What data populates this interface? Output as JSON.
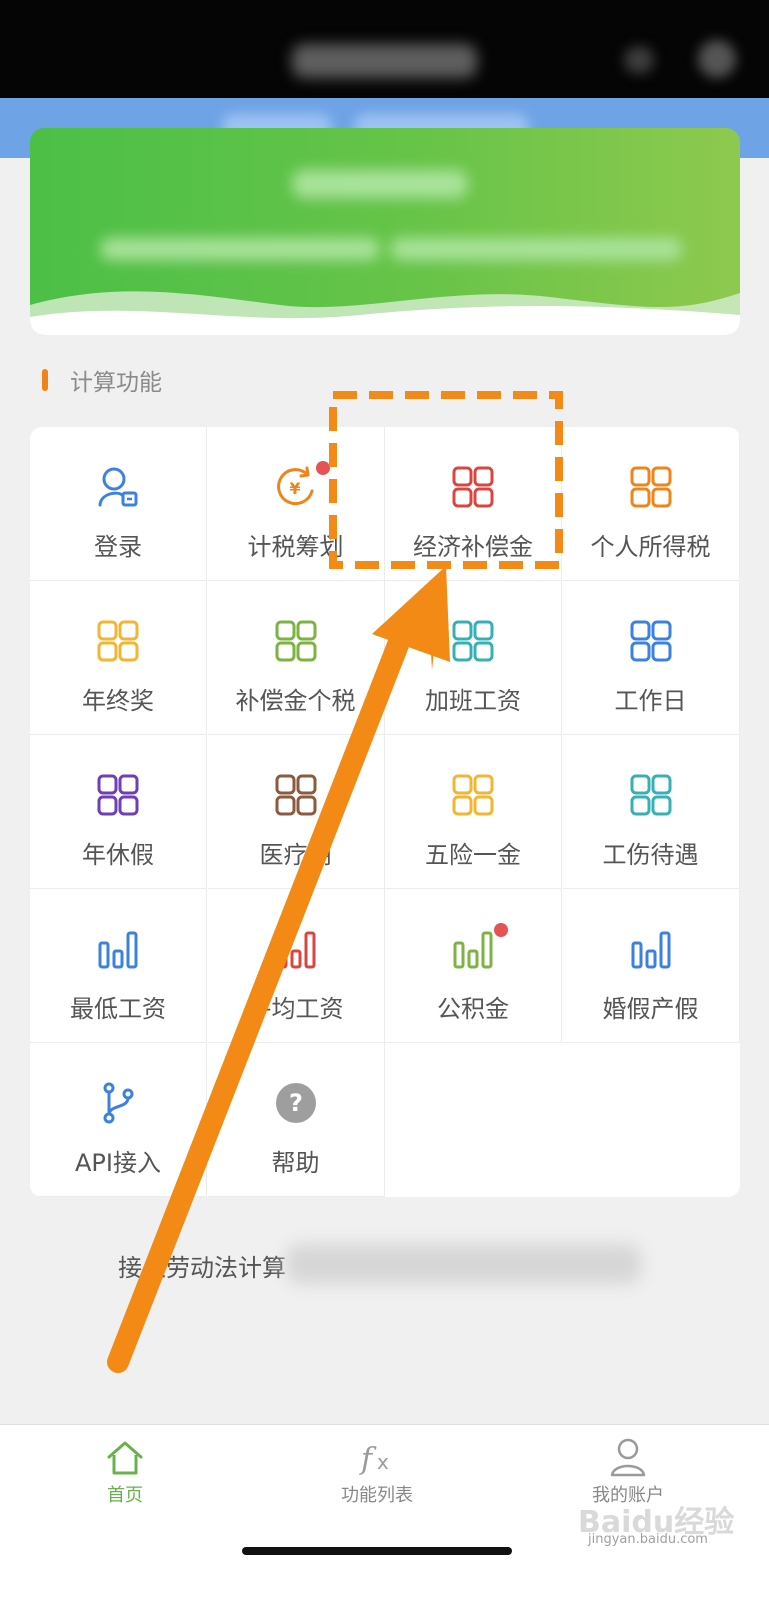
{
  "section": {
    "title": "计算功能"
  },
  "grid": [
    {
      "label": "登录",
      "icon": "user-login-icon",
      "color": "#3b82e0"
    },
    {
      "label": "计税筹划",
      "icon": "yuan-cycle-icon",
      "color": "#f08418",
      "badge": true
    },
    {
      "label": "经济补偿金",
      "icon": "grid-apps-icon",
      "color": "#d9453f"
    },
    {
      "label": "个人所得税",
      "icon": "grid-apps-icon",
      "color": "#f08418"
    },
    {
      "label": "年终奖",
      "icon": "grid-apps-icon",
      "color": "#f2b632"
    },
    {
      "label": "补偿金个税",
      "icon": "grid-apps-icon",
      "color": "#7cb342"
    },
    {
      "label": "加班工资",
      "icon": "grid-apps-icon",
      "color": "#35b0b5"
    },
    {
      "label": "工作日",
      "icon": "grid-apps-icon",
      "color": "#3b82e0"
    },
    {
      "label": "年休假",
      "icon": "grid-apps-icon",
      "color": "#6f3fb8"
    },
    {
      "label": "医疗期",
      "icon": "grid-apps-icon",
      "color": "#8d5a3c"
    },
    {
      "label": "五险一金",
      "icon": "grid-apps-icon",
      "color": "#f2b632"
    },
    {
      "label": "工伤待遇",
      "icon": "grid-apps-icon",
      "color": "#35b0b5"
    },
    {
      "label": "最低工资",
      "icon": "bar-chart-icon",
      "color": "#3b82e0"
    },
    {
      "label": "平均工资",
      "icon": "bar-chart-icon",
      "color": "#d9453f"
    },
    {
      "label": "公积金",
      "icon": "bar-chart-icon",
      "color": "#7cb342",
      "badge": true
    },
    {
      "label": "婚假产假",
      "icon": "bar-chart-icon",
      "color": "#3b82e0"
    },
    {
      "label": "API接入",
      "icon": "branch-icon",
      "color": "#3b82e0"
    },
    {
      "label": "帮助",
      "icon": "question-circle-icon",
      "color": "#9e9e9e"
    }
  ],
  "footer": {
    "text": "接入劳动法计算"
  },
  "tabs": [
    {
      "label": "首页",
      "icon": "home-icon",
      "active": true
    },
    {
      "label": "功能列表",
      "icon": "function-fx-icon",
      "active": false
    },
    {
      "label": "我的账户",
      "icon": "user-account-icon",
      "active": false
    }
  ],
  "colors": {
    "accent": "#f08418",
    "active_tab": "#6ab04c",
    "banner_green": "#5cc247",
    "header_blue": "#6ea3e6"
  },
  "watermark": {
    "brand": "Baidu经验",
    "url": "jingyan.baidu.com"
  }
}
